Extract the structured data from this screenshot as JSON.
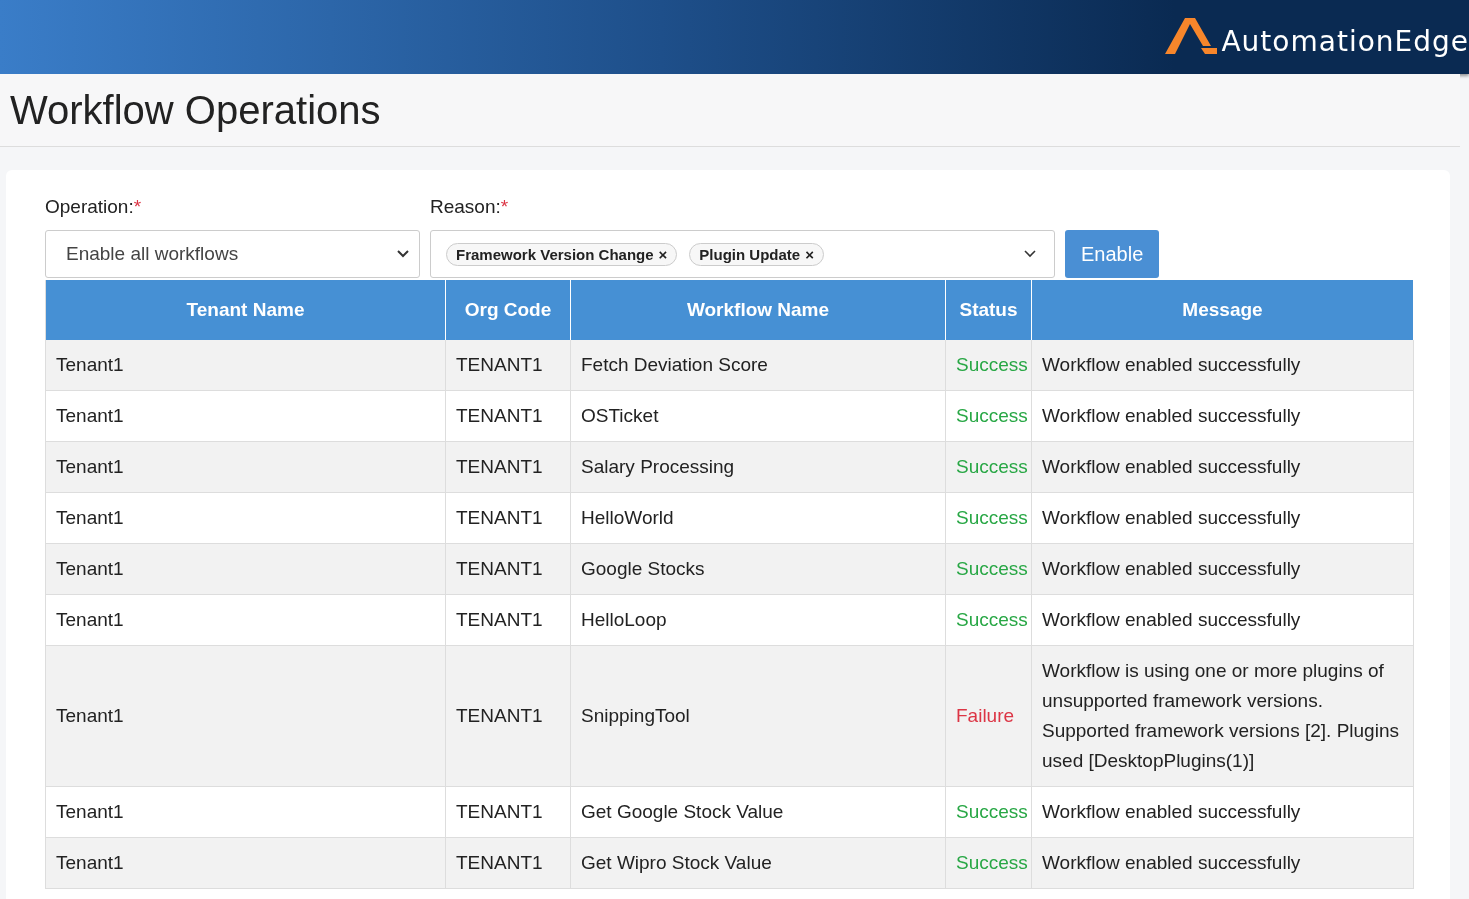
{
  "header": {
    "logo_text": "AutomationEdge"
  },
  "page": {
    "title": "Workflow Operations"
  },
  "form": {
    "operation": {
      "label": "Operation:",
      "required_mark": "*",
      "value": "Enable all workflows"
    },
    "reason": {
      "label": "Reason:",
      "required_mark": "*",
      "tags": [
        {
          "label": "Framework Version Change",
          "remove": "×"
        },
        {
          "label": "Plugin Update",
          "remove": "×"
        }
      ]
    },
    "submit": "Enable"
  },
  "table": {
    "columns": [
      "Tenant Name",
      "Org Code",
      "Workflow Name",
      "Status",
      "Message"
    ],
    "rows": [
      {
        "tenant": "Tenant1",
        "org": "TENANT1",
        "workflow": "Fetch Deviation Score",
        "status": "Success",
        "kind": "success",
        "message": "Workflow enabled successfully"
      },
      {
        "tenant": "Tenant1",
        "org": "TENANT1",
        "workflow": "OSTicket",
        "status": "Success",
        "kind": "success",
        "message": "Workflow enabled successfully"
      },
      {
        "tenant": "Tenant1",
        "org": "TENANT1",
        "workflow": "Salary Processing",
        "status": "Success",
        "kind": "success",
        "message": "Workflow enabled successfully"
      },
      {
        "tenant": "Tenant1",
        "org": "TENANT1",
        "workflow": "HelloWorld",
        "status": "Success",
        "kind": "success",
        "message": "Workflow enabled successfully"
      },
      {
        "tenant": "Tenant1",
        "org": "TENANT1",
        "workflow": "Google Stocks",
        "status": "Success",
        "kind": "success",
        "message": "Workflow enabled successfully"
      },
      {
        "tenant": "Tenant1",
        "org": "TENANT1",
        "workflow": "HelloLoop",
        "status": "Success",
        "kind": "success",
        "message": "Workflow enabled successfully"
      },
      {
        "tenant": "Tenant1",
        "org": "TENANT1",
        "workflow": "SnippingTool",
        "status": "Failure",
        "kind": "failure",
        "message": "Workflow is using one or more plugins of unsupported framework versions. Supported framework versions [2]. Plugins used [DesktopPlugins(1)]"
      },
      {
        "tenant": "Tenant1",
        "org": "TENANT1",
        "workflow": "Get Google Stock Value",
        "status": "Success",
        "kind": "success",
        "message": "Workflow enabled successfully"
      },
      {
        "tenant": "Tenant1",
        "org": "TENANT1",
        "workflow": "Get Wipro Stock Value",
        "status": "Success",
        "kind": "success",
        "message": "Workflow enabled successfully"
      }
    ]
  }
}
